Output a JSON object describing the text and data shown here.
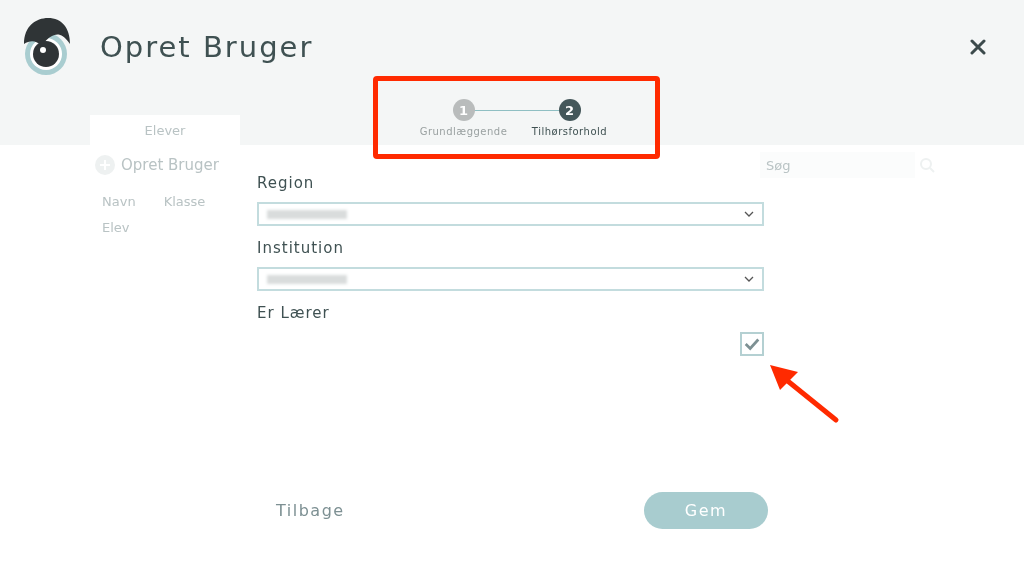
{
  "background": {
    "tab": "Elever",
    "add_button": "Opret Bruger",
    "columns": [
      "Navn",
      "Klasse"
    ],
    "rows": [
      "Elev"
    ],
    "search": {
      "placeholder": "Søg"
    }
  },
  "dialog": {
    "title": "Opret Bruger",
    "steps": [
      {
        "number": "1",
        "label": "Grundlæggende",
        "selected": false
      },
      {
        "number": "2",
        "label": "Tilhørsforhold",
        "selected": true
      }
    ],
    "fields": [
      {
        "kind": "select",
        "label": "Region",
        "value_redacted": true
      },
      {
        "kind": "select",
        "label": "Institution",
        "value_redacted": true
      },
      {
        "kind": "checkbox",
        "label": "Er Lærer",
        "checked": true
      }
    ],
    "buttons": {
      "back": "Tilbage",
      "save": "Gem"
    }
  }
}
